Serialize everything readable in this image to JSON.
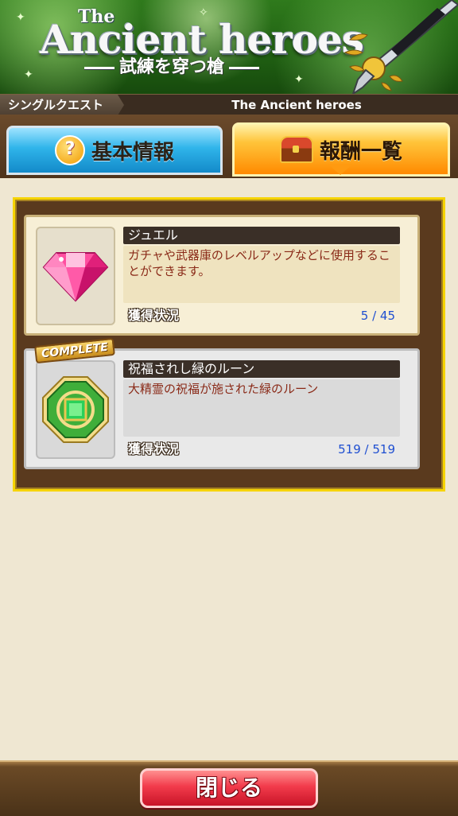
{
  "banner": {
    "title_small": "The",
    "title_main": "Ancient heroes",
    "subtitle": "試練を穿つ槍"
  },
  "breadcrumb": {
    "section": "シングルクエスト",
    "quest": "The Ancient heroes"
  },
  "tabs": [
    {
      "label": "基本情報",
      "icon": "question-icon",
      "active": false
    },
    {
      "label": "報酬一覧",
      "icon": "treasure-chest-icon",
      "active": true
    }
  ],
  "rewards": [
    {
      "name": "ジュエル",
      "description": "ガチャや武器庫のレベルアップなどに使用することができます。",
      "status_label": "獲得状況",
      "count": "5 / 45",
      "icon": "pink-jewel-icon",
      "complete": false
    },
    {
      "name": "祝福されし緑のルーン",
      "description": "大精霊の祝福が施された緑のルーン",
      "status_label": "獲得状況",
      "count": "519 / 519",
      "icon": "green-rune-icon",
      "complete": true,
      "badge": "COMPLETE"
    }
  ],
  "footer": {
    "close_label": "閉じる"
  },
  "colors": {
    "accent_gold": "#f6d400",
    "count_blue": "#1f4fd1",
    "close_red": "#f23b4b"
  }
}
